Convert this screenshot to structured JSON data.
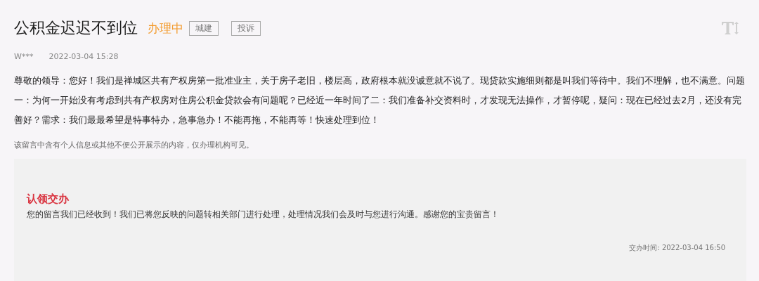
{
  "title": "公积金迟迟不到位",
  "status": "办理中",
  "tags": [
    "城建",
    "投诉"
  ],
  "author": "W***",
  "time": "2022-03-04 15:28",
  "content": "尊敬的领导：您好！我们是禅城区共有产权房第一批准业主，关于房子老旧，楼层高，政府根本就没诚意就不说了。现贷款实施细则都是叫我们等待中。我们不理解，也不满意。问题一：为何一开始没有考虑到共有产权房对住房公积金贷款会有问题呢？已经近一年时间了二：我们准备补交资料时，才发现无法操作，才暂停呢，疑问：现在已经过去2月，还没有完善好？需求：我们最最希望是特事特办，急事急办！不能再拖，不能再等！快速处理到位！",
  "privacy_note": "该留言中含有个人信息或其他不便公开展示的内容，仅办理机构可见。",
  "reply": {
    "heading": "认领交办",
    "text": "您的留言我们已经收到！我们已将您反映的问题转相关部门进行处理，处理情况我们会及时与您进行沟通。感谢您的宝贵留言！",
    "time": "交办时间: 2022-03-04 16:50"
  }
}
